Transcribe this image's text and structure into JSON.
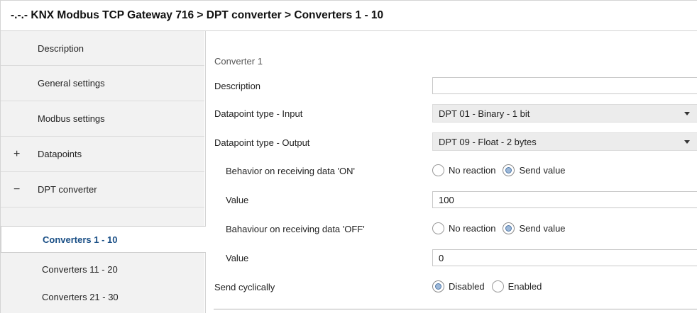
{
  "title": "-.-.- KNX Modbus TCP Gateway 716 > DPT converter > Converters 1 - 10",
  "sidebar": {
    "items": [
      {
        "label": "Description",
        "prefix": ""
      },
      {
        "label": "General settings",
        "prefix": ""
      },
      {
        "label": "Modbus settings",
        "prefix": ""
      },
      {
        "label": "Datapoints",
        "prefix": "+"
      },
      {
        "label": "DPT converter",
        "prefix": "−"
      }
    ],
    "subitems": [
      {
        "label": "Converters 1 - 10",
        "active": true
      },
      {
        "label": "Converters 11 - 20",
        "active": false
      },
      {
        "label": "Converters 21 - 30",
        "active": false
      }
    ]
  },
  "main": {
    "section": "Converter 1",
    "description_label": "Description",
    "description_value": "",
    "dpt_input_label": "Datapoint type - Input",
    "dpt_input_value": "DPT 01 - Binary - 1 bit",
    "dpt_output_label": "Datapoint type - Output",
    "dpt_output_value": "DPT 09 - Float - 2 bytes",
    "on_label": "Behavior on receiving data 'ON'",
    "on_options": [
      "No reaction",
      "Send value"
    ],
    "on_selected": "Send value",
    "on_value_label": "Value",
    "on_value": "100",
    "off_label": "Bahaviour on receiving data 'OFF'",
    "off_options": [
      "No reaction",
      "Send value"
    ],
    "off_selected": "Send value",
    "off_value_label": "Value",
    "off_value": "0",
    "cyclic_label": "Send cyclically",
    "cyclic_options": [
      "Disabled",
      "Enabled"
    ],
    "cyclic_selected": "Disabled"
  },
  "colors": {
    "sidebar_bg": "#f2f2f2",
    "active_text": "#1a4f86",
    "radio_fill": "#9db8d8"
  }
}
